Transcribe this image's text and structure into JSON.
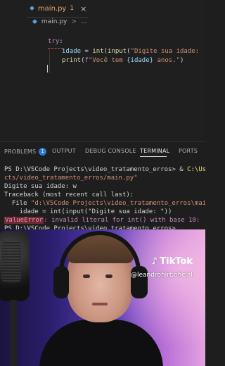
{
  "editor": {
    "tab": {
      "filename": "main.py",
      "badge": "1",
      "close": "×"
    },
    "breadcrumb": {
      "file": "main.py",
      "separator": ">",
      "more": "..."
    },
    "code": {
      "line1_kw": "try",
      "line1_colon": ":",
      "line2_var": "idade",
      "line2_eq": " = ",
      "line2_int": "int",
      "line2_open": "(",
      "line2_input": "input",
      "line2_paren": "(",
      "line2_str": "\"Digite sua idade: ",
      "line3_print": "print",
      "line3_paren": "(",
      "line3_f": "f",
      "line3_str1": "\"Você tem ",
      "line3_brace": "{idade}",
      "line3_str2": " anos.\"",
      "line3_close": ")"
    }
  },
  "panel": {
    "tabs": {
      "problems": "PROBLEMS",
      "problems_count": "1",
      "output": "OUTPUT",
      "debug_console": "DEBUG CONSOLE",
      "terminal": "TERMINAL",
      "ports": "PORTS"
    }
  },
  "terminal": {
    "l1_prompt": "PS D:\\VSCode Projects\\video_tratamento_erros> & ",
    "l1_path": "C:\\User",
    "l2": "cts/video_tratamento_erros/main.py\"",
    "l3": "Digite sua idade: w",
    "l4": "Traceback (most recent call last):",
    "l5_pre": "  File ",
    "l5_path": "\"d:\\VSCode Projects\\video_tratamento_erros\\main",
    "l6": "    idade = int(input(\"Digite sua idade: \"))",
    "l7_label": "ValueError",
    "l7_msg": ": invalid literal for int() with base 10: 'w",
    "l8": "PS D:\\VSCode Projects\\video_tratamento_erros> "
  },
  "overlay": {
    "tiktok_name": "TikTok",
    "tiktok_handle": "@leandrohirt.oficial"
  },
  "colors": {
    "keyword": "#c586c0",
    "function": "#dcdcaa",
    "variable": "#9cdcfe",
    "string": "#ce9178",
    "tab_modified": "#e8a26a",
    "problems_badge": "#2a7ad4"
  }
}
